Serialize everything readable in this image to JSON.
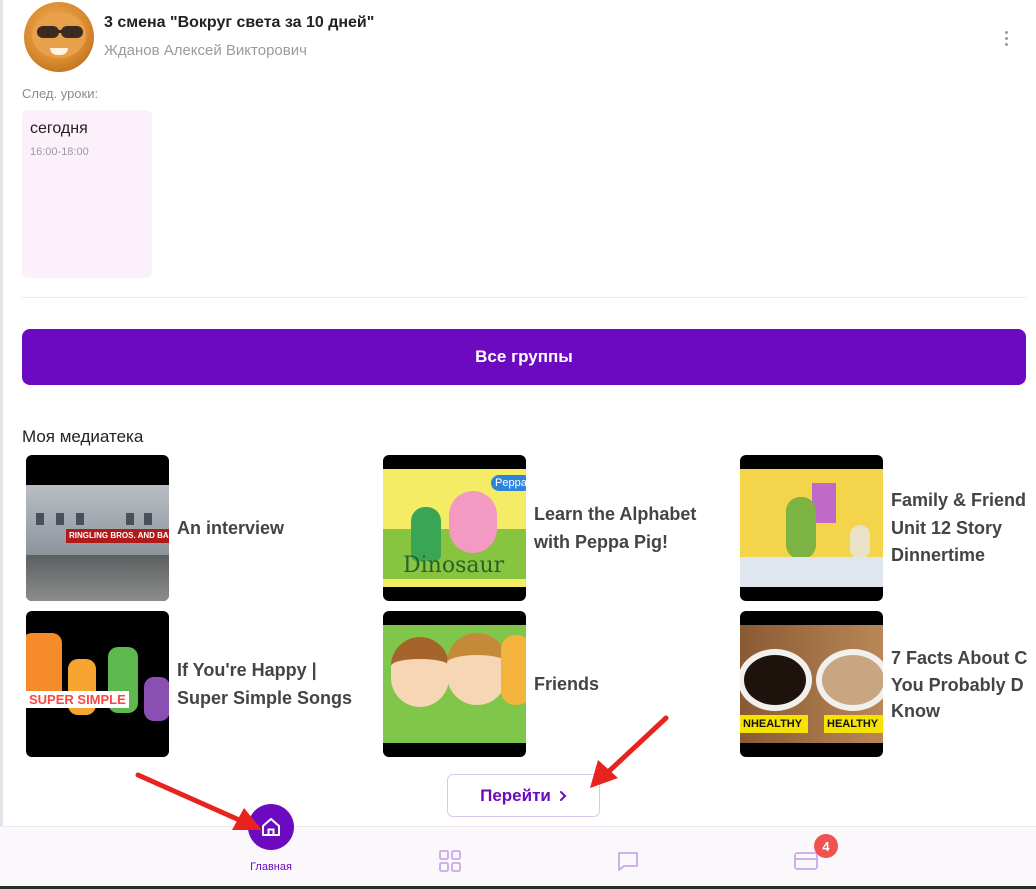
{
  "group": {
    "title": "3 смена \"Вокруг света за 10 дней\"",
    "teacher": "Жданов Алексей Викторович",
    "more_icon": "more-vertical-icon"
  },
  "next_lessons": {
    "label": "След. уроки:",
    "items": [
      {
        "day": "сегодня",
        "time": "16:00-18:00"
      }
    ]
  },
  "all_groups_button": "Все группы",
  "media": {
    "title": "Моя медиатека",
    "items": [
      {
        "lines": [
          "An interview"
        ],
        "thumb_text": "RINGLING BROS. AND BARNUM"
      },
      {
        "lines": [
          "Learn the Alphabet",
          "with Peppa Pig!"
        ],
        "thumb_text": "Dinosaur",
        "thumb_logo": "Peppa"
      },
      {
        "lines": [
          "Family & Friend",
          "Unit 12 Story",
          "Dinnertime"
        ]
      },
      {
        "lines": [
          "If You're Happy |",
          "Super Simple Songs"
        ],
        "thumb_text": "SUPER SIMPLE"
      },
      {
        "lines": [
          "Friends"
        ]
      },
      {
        "lines": [
          "7 Facts About C",
          "You Probably D",
          "Know"
        ],
        "thumb_tags": [
          "NHEALTHY",
          "HEALTHY"
        ]
      }
    ],
    "goto_button": "Перейти",
    "goto_icon": "chevron-right-icon"
  },
  "bottom_nav": {
    "items": [
      {
        "icon": "home-icon",
        "label": "Главная"
      },
      {
        "icon": "grid-icon"
      },
      {
        "icon": "chat-icon"
      },
      {
        "icon": "card-icon",
        "badge": "4"
      }
    ]
  },
  "colors": {
    "accent": "#6b0ac0",
    "badge": "#f0524f",
    "annotation": "#e8231d"
  }
}
